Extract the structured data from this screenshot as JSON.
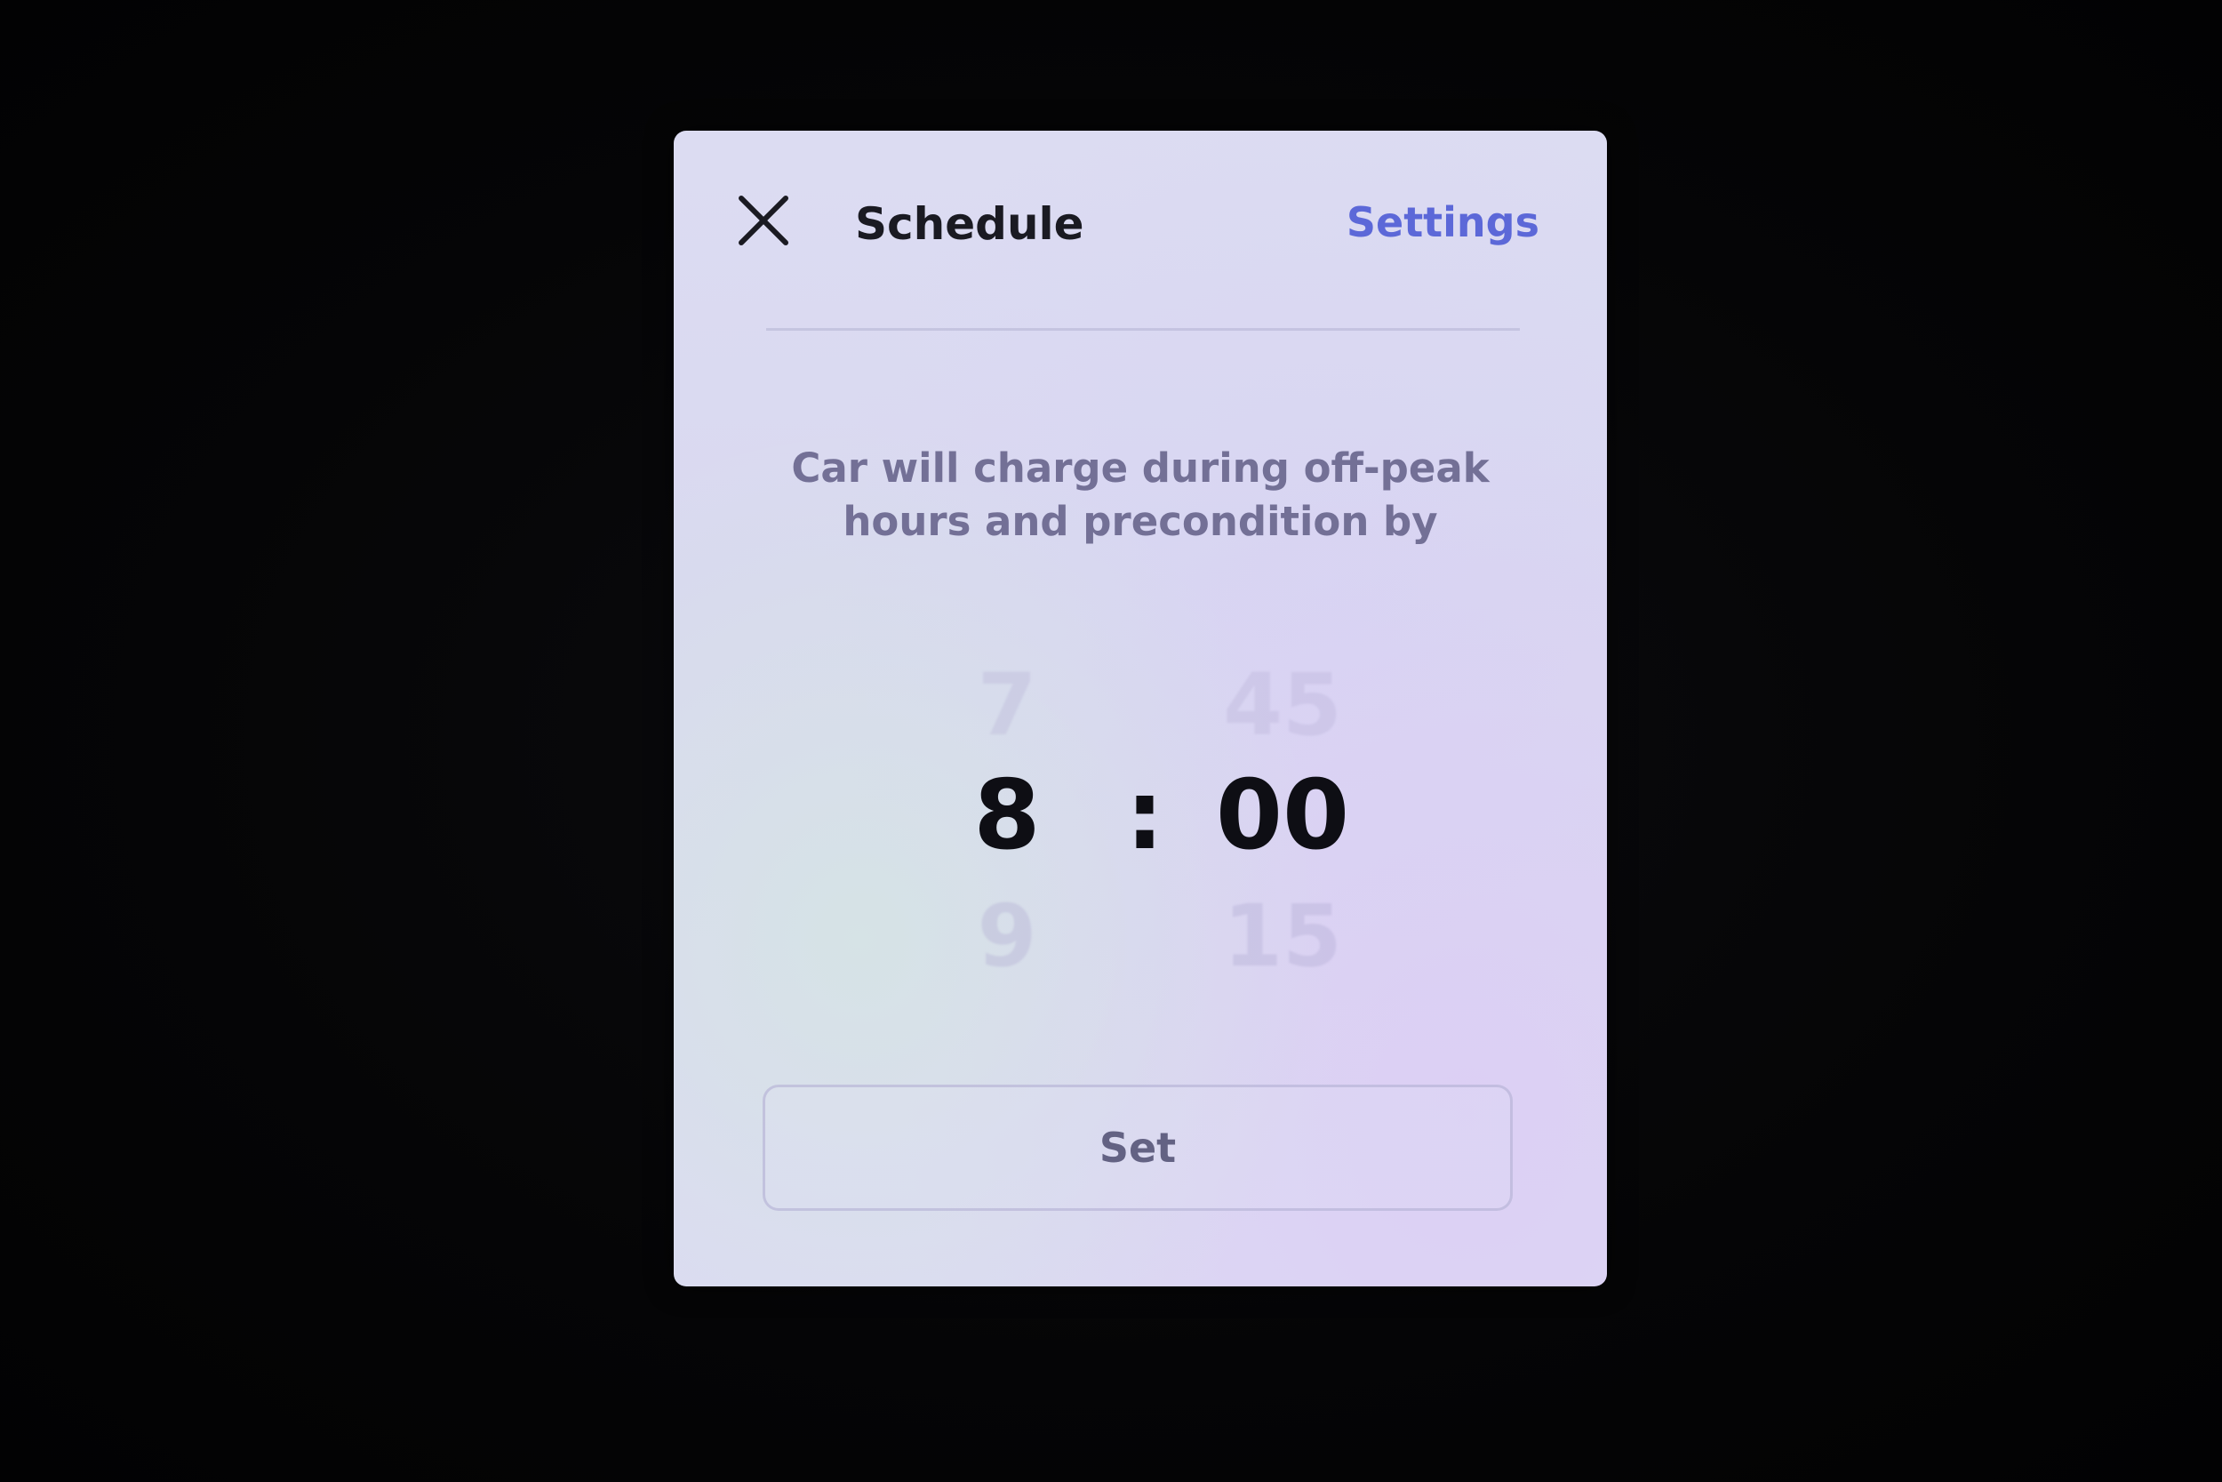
{
  "dialog": {
    "title": "Schedule",
    "settings_label": "Settings",
    "message": "Car will charge during off-peak hours and precondition by"
  },
  "time_picker": {
    "hour": {
      "prev": "7",
      "current": "8",
      "next": "9"
    },
    "separator": ":",
    "minute": {
      "prev": "45",
      "current": "00",
      "next": "15"
    }
  },
  "actions": {
    "set_label": "Set"
  },
  "icons": {
    "close": "close-icon"
  },
  "colors": {
    "accent": "#5c68d8",
    "dialog_bg": "#dcdcf2",
    "text_primary": "#1a1a22",
    "text_secondary": "#737096"
  }
}
